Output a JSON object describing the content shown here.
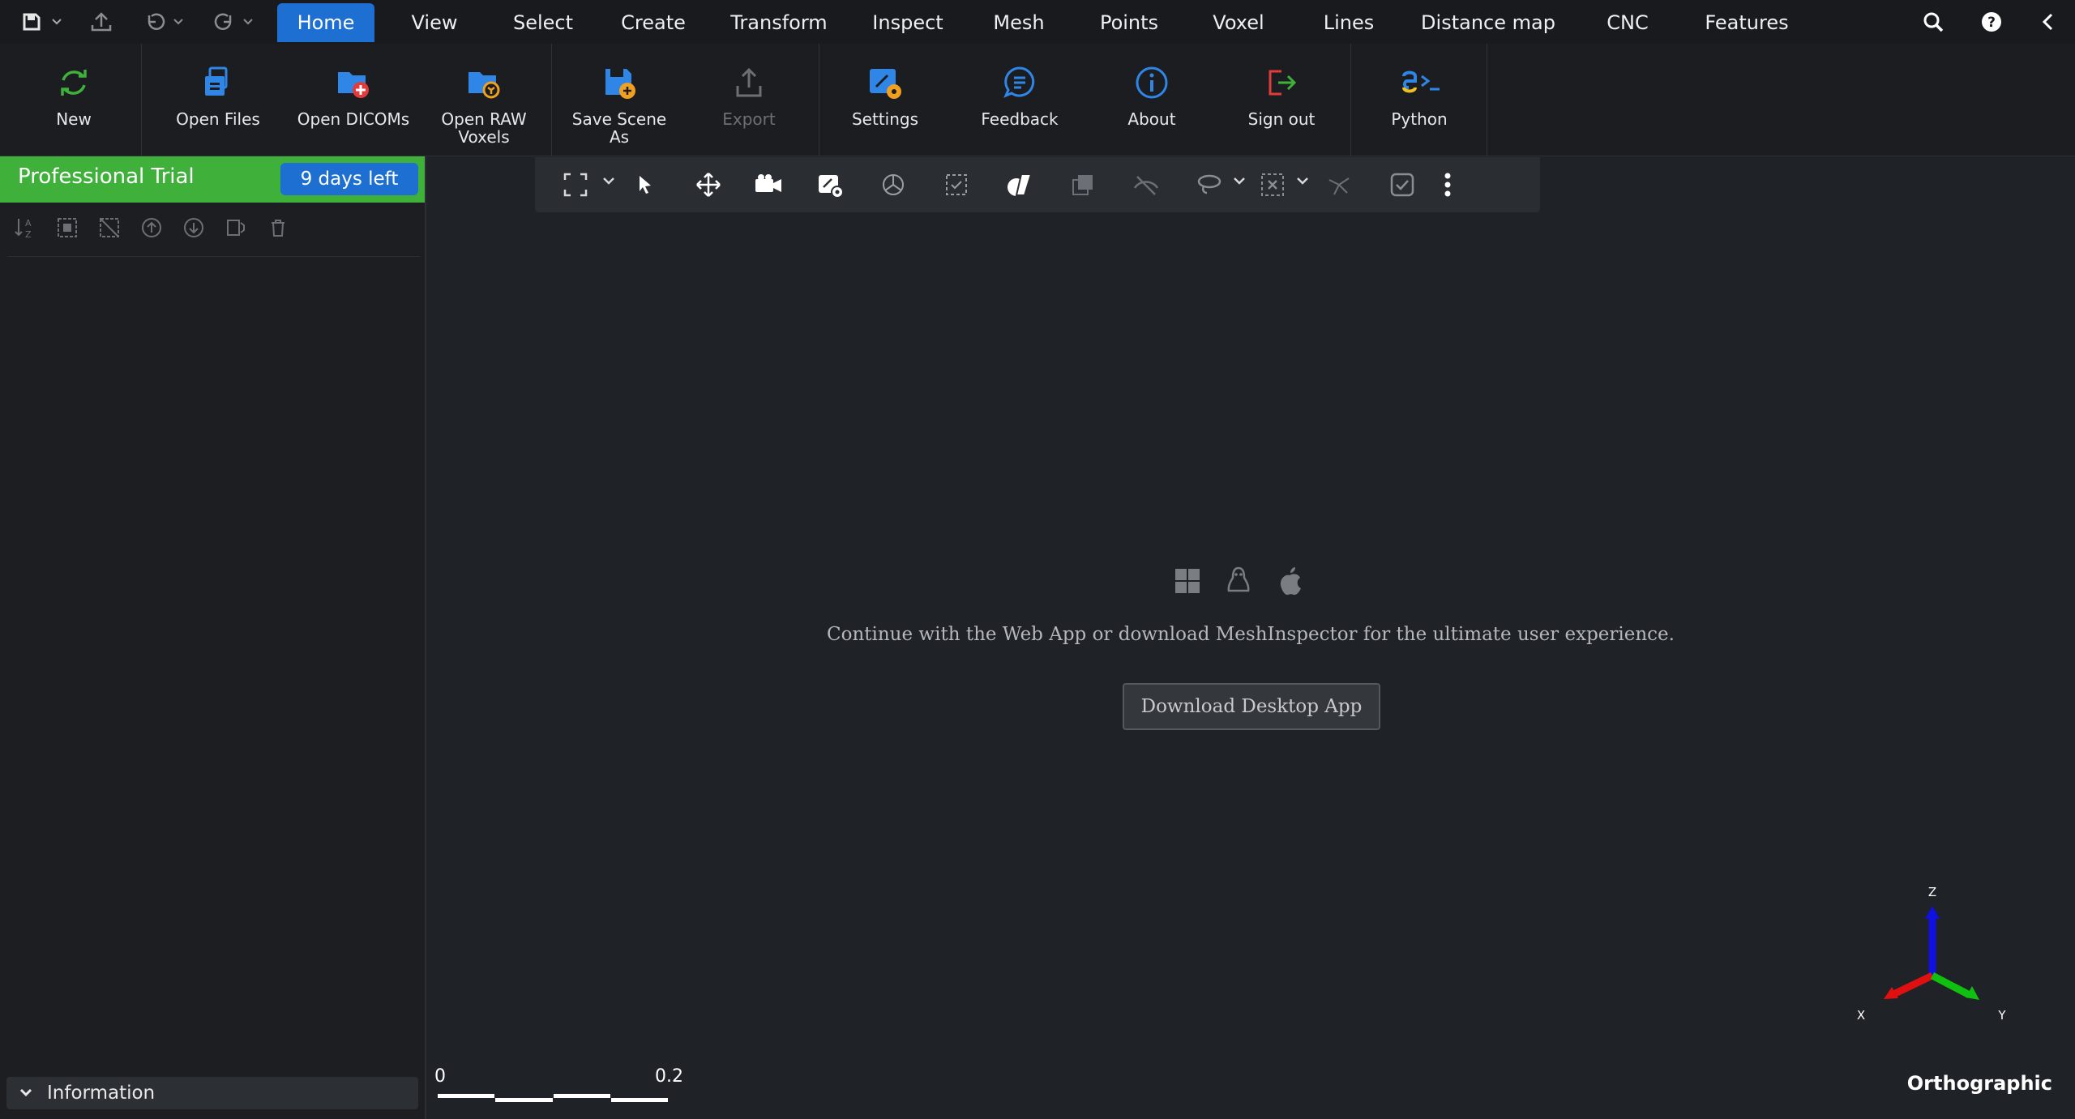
{
  "menubar": {
    "tabs": [
      {
        "label": "Home",
        "active": true
      },
      {
        "label": "View"
      },
      {
        "label": "Select"
      },
      {
        "label": "Create"
      },
      {
        "label": "Transform"
      },
      {
        "label": "Inspect"
      },
      {
        "label": "Mesh"
      },
      {
        "label": "Points"
      },
      {
        "label": "Voxel"
      },
      {
        "label": "Lines"
      },
      {
        "label": "Distance map"
      },
      {
        "label": "CNC"
      },
      {
        "label": "Features"
      }
    ],
    "right_icons": [
      "search-icon",
      "help-icon",
      "collapse-icon"
    ]
  },
  "ribbon": {
    "buttons": [
      {
        "label": "New",
        "icon": "refresh-icon"
      },
      {
        "label": "Open Files",
        "icon": "open-files-icon",
        "dropdown": true
      },
      {
        "label": "Open DICOMs",
        "icon": "open-dicoms-icon"
      },
      {
        "label": "Open RAW Voxels",
        "icon": "open-raw-voxels-icon"
      },
      {
        "label": "Save Scene As",
        "icon": "save-scene-icon"
      },
      {
        "label": "Export",
        "icon": "export-icon",
        "disabled": true
      },
      {
        "label": "Settings",
        "icon": "settings-icon"
      },
      {
        "label": "Feedback",
        "icon": "feedback-icon",
        "dropdown": true
      },
      {
        "label": "About",
        "icon": "info-icon"
      },
      {
        "label": "Sign out",
        "icon": "sign-out-icon"
      },
      {
        "label": "Python",
        "icon": "python-icon"
      }
    ]
  },
  "left_panel": {
    "trial_label": "Professional Trial",
    "trial_badge": "9 days left",
    "info_label": "Information"
  },
  "viewport": {
    "promo_text": "Continue with the Web App or download MeshInspector for the ultimate user experience.",
    "download_button": "Download Desktop App",
    "scale_min": "0",
    "scale_max": "0.2",
    "axis_x": "X",
    "axis_y": "Y",
    "axis_z": "Z",
    "projection": "Orthographic"
  },
  "colors": {
    "accent": "#1d6fd1",
    "trial_green": "#3fb13a",
    "background": "#1f2226"
  }
}
